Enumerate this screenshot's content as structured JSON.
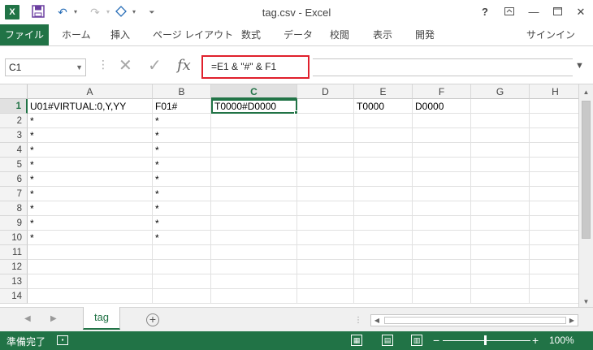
{
  "titlebar": {
    "app_logo": "X",
    "title": "tag.csv - Excel",
    "help": "?",
    "icons": [
      "save-icon",
      "undo-icon",
      "redo-icon",
      "touch-mode-icon",
      "customize-qat-icon"
    ],
    "window_buttons": [
      "ribbon-display-options",
      "minimize",
      "maximize",
      "close"
    ]
  },
  "ribbon": {
    "tabs": [
      "ファイル",
      "ホーム",
      "挿入",
      "ページ レイアウト",
      "数式",
      "データ",
      "校閲",
      "表示",
      "開発"
    ],
    "signin": "サインイン"
  },
  "formula_bar": {
    "name_box": "C1",
    "formula": "=E1 & \"#\" & F1"
  },
  "grid": {
    "columns": [
      "A",
      "B",
      "C",
      "D",
      "E",
      "F",
      "G",
      "H"
    ],
    "rows": [
      "1",
      "2",
      "3",
      "4",
      "5",
      "6",
      "7",
      "8",
      "9",
      "10",
      "11",
      "12",
      "13",
      "14"
    ],
    "cells": {
      "A1": "U01#VIRTUAL:0,Y,YY",
      "B1": "F01#",
      "C1": "T0000#D0000",
      "E1": "T0000",
      "F1": "D0000",
      "A2": "*",
      "B2": "*",
      "A3": "*",
      "B3": "*",
      "A4": "*",
      "B4": "*",
      "A5": "*",
      "B5": "*",
      "A6": "*",
      "B6": "*",
      "A7": "*",
      "B7": "*",
      "A8": "*",
      "B8": "*",
      "A9": "*",
      "B9": "*",
      "A10": "*",
      "B10": "*"
    },
    "active_cell": "C1"
  },
  "sheets": {
    "active": "tag"
  },
  "statusbar": {
    "status": "準備完了",
    "zoom": "100%"
  },
  "colors": {
    "excel_green": "#217346",
    "highlight_red": "#e0202c"
  }
}
